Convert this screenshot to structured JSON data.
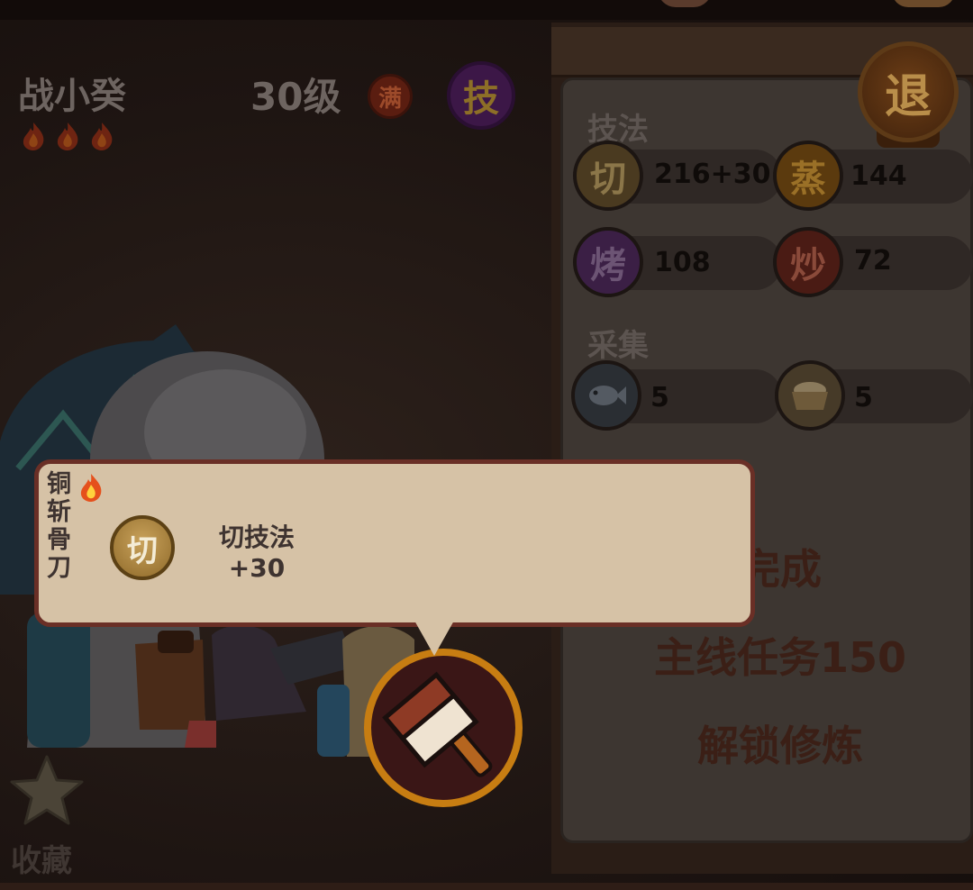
{
  "character": {
    "name": "战小癸",
    "level": "30级",
    "max_badge": "满",
    "skill_button": "技",
    "stars": 3
  },
  "panel": {
    "exit_label": "退",
    "skills_title": "技法",
    "skills": [
      {
        "icon": "切",
        "value": "216+30",
        "color": "#8e6b2f"
      },
      {
        "icon": "蒸",
        "value": "144",
        "color": "#b06e12"
      },
      {
        "icon": "烤",
        "value": "108",
        "color": "#5a2d6d"
      },
      {
        "icon": "炒",
        "value": "72",
        "color": "#7a1e14"
      }
    ],
    "gather_title": "采集",
    "gather": [
      {
        "icon": "fish-icon",
        "value": "5"
      },
      {
        "icon": "grain-bowl-icon",
        "value": "5"
      }
    ],
    "task_lines": [
      "完成",
      "主线任务150",
      "解锁修炼"
    ]
  },
  "tooltip": {
    "item_name": "铜斩骨刀",
    "item_name_chars": [
      "铜",
      "斩",
      "骨",
      "刀"
    ],
    "skill_icon": "切",
    "effect_line1": "切技法",
    "effect_line2": "+30"
  },
  "equipment": {
    "icon": "cleaver-icon"
  },
  "favorites": {
    "label": "收藏"
  },
  "colors": {
    "tooltip_bg": "#d6c2a6",
    "tooltip_border": "#6a2f26",
    "slot_ring": "#c77d12"
  }
}
